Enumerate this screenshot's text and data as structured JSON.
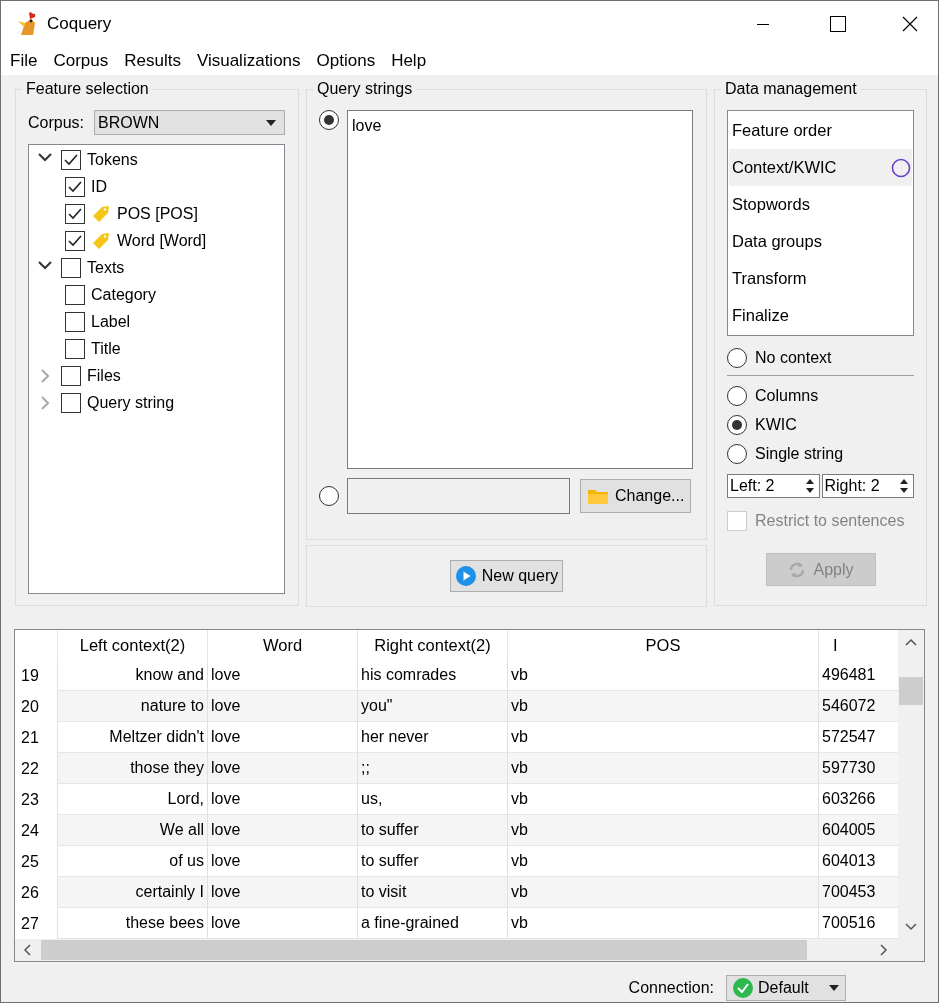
{
  "window": {
    "title": "Coquery"
  },
  "menu": [
    {
      "label": "File"
    },
    {
      "label": "Corpus"
    },
    {
      "label": "Results"
    },
    {
      "label": "Visualizations"
    },
    {
      "label": "Options"
    },
    {
      "label": "Help"
    }
  ],
  "feature_selection": {
    "title": "Feature selection",
    "corpus_label": "Corpus:",
    "corpus": "BROWN",
    "tree": [
      {
        "label": "Tokens",
        "checked": true,
        "expanded": true,
        "children": [
          {
            "label": "ID",
            "checked": true,
            "kind": "plain"
          },
          {
            "label": "POS [POS]",
            "checked": true,
            "kind": "tagged"
          },
          {
            "label": "Word [Word]",
            "checked": true,
            "kind": "tagged"
          }
        ]
      },
      {
        "label": "Texts",
        "checked": false,
        "expanded": true,
        "children": [
          {
            "label": "Category",
            "checked": false,
            "kind": "plain"
          },
          {
            "label": "Label",
            "checked": false,
            "kind": "plain"
          },
          {
            "label": "Title",
            "checked": false,
            "kind": "plain"
          }
        ]
      },
      {
        "label": "Files",
        "checked": false,
        "expanded": false
      },
      {
        "label": "Query string",
        "checked": false,
        "expanded": false
      }
    ]
  },
  "query_strings": {
    "title": "Query strings",
    "sources": [
      {
        "kind": "text",
        "selected": true,
        "value": "love"
      },
      {
        "kind": "file",
        "selected": false,
        "button": "Change..."
      }
    ],
    "new_query": "New query"
  },
  "data_management": {
    "title": "Data management",
    "items": [
      {
        "label": "Feature order",
        "selected": false
      },
      {
        "label": "Context/KWIC",
        "selected": true
      },
      {
        "label": "Stopwords",
        "selected": false
      },
      {
        "label": "Data groups",
        "selected": false
      },
      {
        "label": "Transform",
        "selected": false
      },
      {
        "label": "Finalize",
        "selected": false
      }
    ],
    "context_modes": [
      {
        "label": "No context",
        "selected": false
      },
      {
        "label": "Columns",
        "selected": false
      },
      {
        "label": "KWIC",
        "selected": true
      },
      {
        "label": "Single string",
        "selected": false
      }
    ],
    "left": "Left: 2",
    "right": "Right: 2",
    "restrict": {
      "label": "Restrict to sentences",
      "checked": false,
      "disabled": true
    },
    "apply": {
      "label": "Apply",
      "disabled": true
    }
  },
  "table": {
    "columns": [
      "Left context(2)",
      "Word",
      "Right context(2)",
      "POS",
      "I"
    ],
    "rows": [
      {
        "number": "19",
        "cells": [
          "know and",
          "love",
          "his comrades",
          "vb",
          "496481"
        ]
      },
      {
        "number": "20",
        "cells": [
          "nature to",
          "love",
          "you\"",
          "vb",
          "546072"
        ]
      },
      {
        "number": "21",
        "cells": [
          "Meltzer didn't",
          "love",
          "her never",
          "vb",
          "572547"
        ]
      },
      {
        "number": "22",
        "cells": [
          "those they",
          "love",
          ";;",
          "vb",
          "597730"
        ]
      },
      {
        "number": "23",
        "cells": [
          "Lord,",
          "love",
          "us,",
          "vb",
          "603266"
        ]
      },
      {
        "number": "24",
        "cells": [
          "We all",
          "love",
          "to suffer",
          "vb",
          "604005"
        ]
      },
      {
        "number": "25",
        "cells": [
          "of us",
          "love",
          "to suffer",
          "vb",
          "604013"
        ]
      },
      {
        "number": "26",
        "cells": [
          "certainly I",
          "love",
          "to visit",
          "vb",
          "700453"
        ]
      },
      {
        "number": "27",
        "cells": [
          "these bees",
          "love",
          "a fine-grained",
          "vb",
          "700516"
        ]
      }
    ]
  },
  "status_bar": {
    "label": "Connection:",
    "connection": "Default"
  }
}
